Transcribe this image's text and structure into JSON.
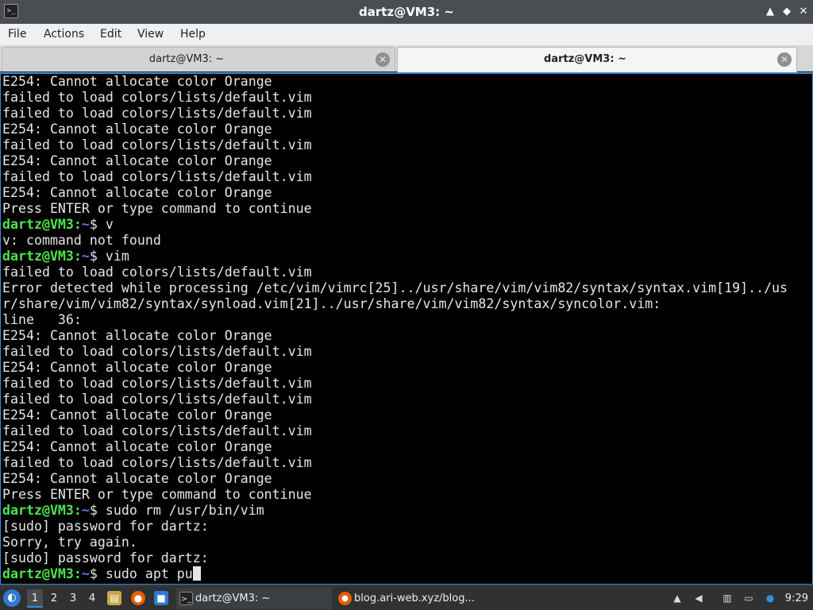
{
  "window": {
    "title": "dartz@VM3: ~",
    "app_icon": ">_",
    "minimize_glyph": "▲",
    "maximize_glyph": "◆",
    "close_glyph": "✕"
  },
  "menu": {
    "items": [
      "File",
      "Actions",
      "Edit",
      "View",
      "Help"
    ]
  },
  "tabs": [
    {
      "label": "dartz@VM3: ~",
      "active": false
    },
    {
      "label": "dartz@VM3: ~",
      "active": true
    }
  ],
  "terminal": {
    "lines": [
      {
        "text": "E254: Cannot allocate color Orange"
      },
      {
        "text": "failed to load colors/lists/default.vim"
      },
      {
        "text": "failed to load colors/lists/default.vim"
      },
      {
        "text": "E254: Cannot allocate color Orange"
      },
      {
        "text": "failed to load colors/lists/default.vim"
      },
      {
        "text": "E254: Cannot allocate color Orange"
      },
      {
        "text": "failed to load colors/lists/default.vim"
      },
      {
        "text": "E254: Cannot allocate color Orange"
      },
      {
        "text": "Press ENTER or type command to continue"
      },
      {
        "prompt": true,
        "user": "dartz@VM3:",
        "path": "~",
        "cmd": "$ v"
      },
      {
        "text": "v: command not found"
      },
      {
        "prompt": true,
        "user": "dartz@VM3:",
        "path": "~",
        "cmd": "$ vim"
      },
      {
        "text": "failed to load colors/lists/default.vim"
      },
      {
        "text": "Error detected while processing /etc/vim/vimrc[25]../usr/share/vim/vim82/syntax/syntax.vim[19]../us"
      },
      {
        "text": "r/share/vim/vim82/syntax/synload.vim[21]../usr/share/vim/vim82/syntax/syncolor.vim:"
      },
      {
        "text": "line   36:"
      },
      {
        "text": "E254: Cannot allocate color Orange"
      },
      {
        "text": "failed to load colors/lists/default.vim"
      },
      {
        "text": "E254: Cannot allocate color Orange"
      },
      {
        "text": "failed to load colors/lists/default.vim"
      },
      {
        "text": "failed to load colors/lists/default.vim"
      },
      {
        "text": "E254: Cannot allocate color Orange"
      },
      {
        "text": "failed to load colors/lists/default.vim"
      },
      {
        "text": "E254: Cannot allocate color Orange"
      },
      {
        "text": "failed to load colors/lists/default.vim"
      },
      {
        "text": "E254: Cannot allocate color Orange"
      },
      {
        "text": "Press ENTER or type command to continue"
      },
      {
        "prompt": true,
        "user": "dartz@VM3:",
        "path": "~",
        "cmd": "$ sudo rm /usr/bin/vim"
      },
      {
        "text": "[sudo] password for dartz:"
      },
      {
        "text": "Sorry, try again."
      },
      {
        "text": "[sudo] password for dartz:"
      },
      {
        "prompt": true,
        "user": "dartz@VM3:",
        "path": "~",
        "cmd": "$ sudo apt pu",
        "cursor": true
      }
    ]
  },
  "taskbar": {
    "start_icon": "start-menu-icon",
    "workspaces": [
      "1",
      "2",
      "3",
      "4"
    ],
    "active_workspace": "1",
    "quick_launch": [
      {
        "name": "file-manager-icon",
        "glyph": "▤"
      },
      {
        "name": "firefox-icon",
        "glyph": "●"
      },
      {
        "name": "desktop-icon",
        "glyph": "■"
      }
    ],
    "tasks": [
      {
        "label": "dartz@VM3: ~",
        "icon": "terminal-icon",
        "glyph": ">_",
        "active": true
      },
      {
        "label": "blog.ari-web.xyz/blog...",
        "icon": "firefox-icon",
        "glyph": "●",
        "active": false
      }
    ],
    "tray": [
      {
        "name": "update-icon",
        "glyph": "▲"
      },
      {
        "name": "volume-icon",
        "glyph": "◀"
      },
      {
        "name": "clipboard-icon",
        "glyph": "▥"
      },
      {
        "name": "network-icon",
        "glyph": "▭"
      },
      {
        "name": "notification-icon",
        "glyph": "●"
      }
    ],
    "clock": "9:29",
    "colors": {
      "accent": "#3b8ed6",
      "firefox": "#e66000",
      "files": "#c9a74a",
      "desktop": "#2e7bcf"
    }
  }
}
